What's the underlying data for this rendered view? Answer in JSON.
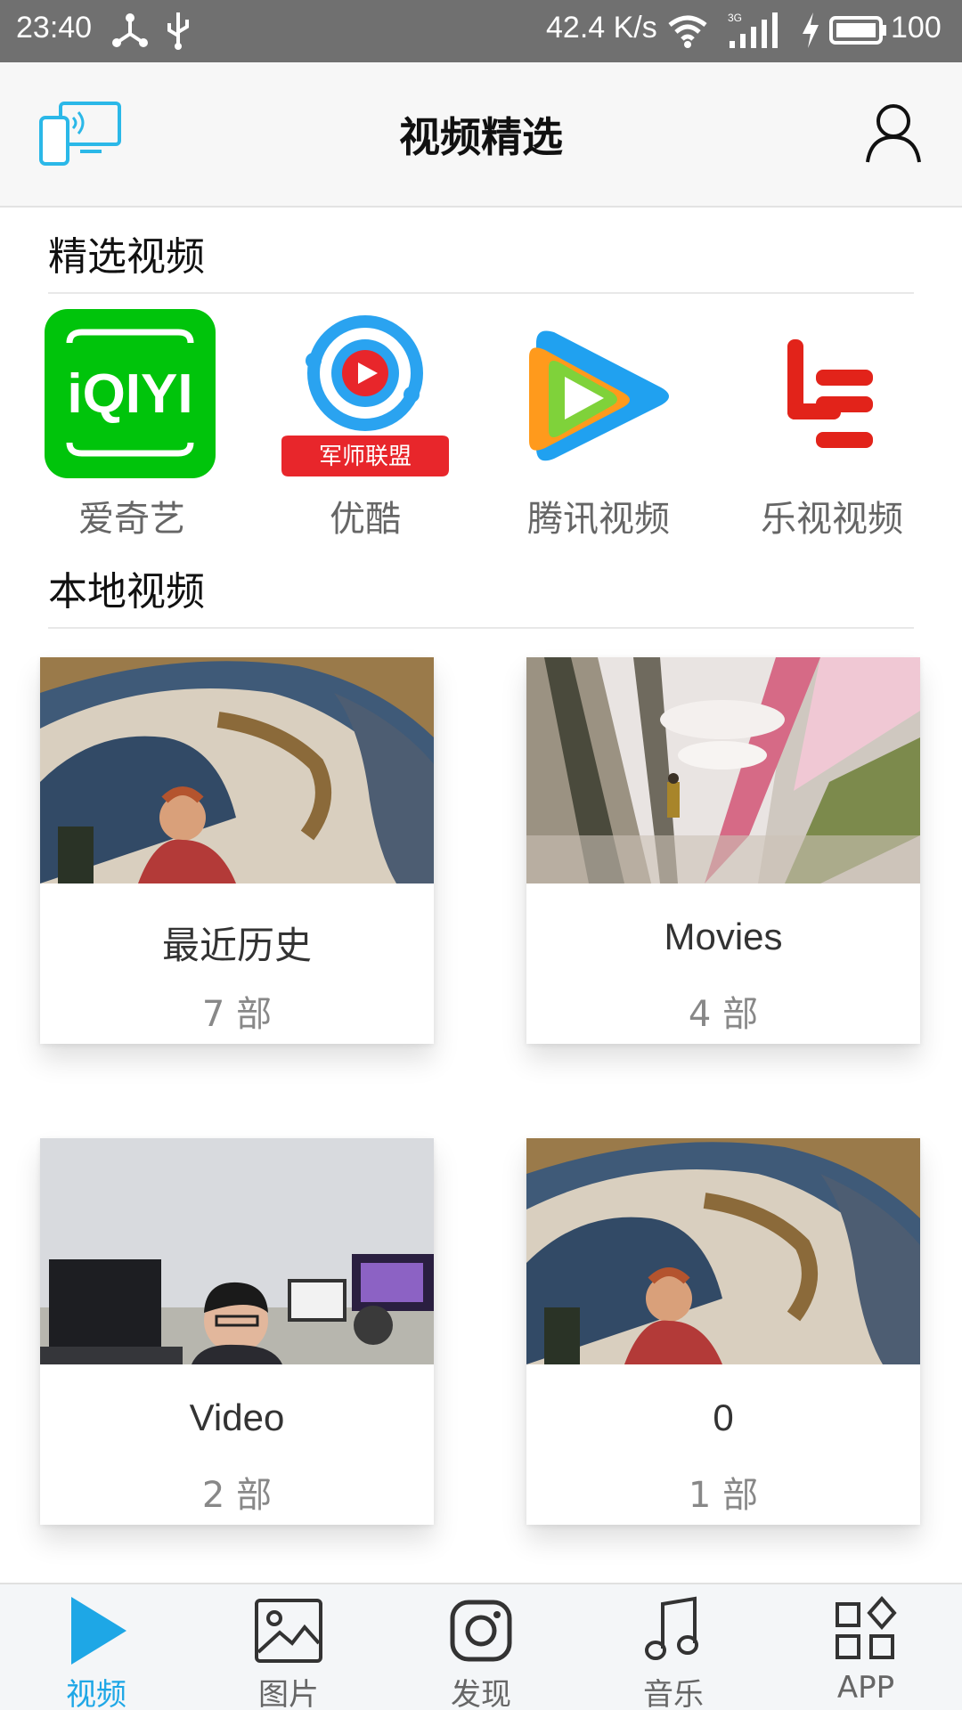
{
  "status_bar": {
    "time": "23:40",
    "speed": "42.4 K/s",
    "network": "3G",
    "battery": "100"
  },
  "header": {
    "title": "视频精选",
    "cast_icon": "screen-cast-icon",
    "user_icon": "user-icon"
  },
  "featured": {
    "heading": "精选视频",
    "apps": [
      {
        "name": "爱奇艺",
        "logo_text": "iQIYI",
        "icon": "iqiyi-logo"
      },
      {
        "name": "优酷",
        "logo_text": "军师联盟",
        "icon": "youku-logo"
      },
      {
        "name": "腾讯视频",
        "icon": "tencent-video-logo"
      },
      {
        "name": "乐视视频",
        "icon": "letv-logo"
      }
    ]
  },
  "local": {
    "heading": "本地视频",
    "folders": [
      {
        "label": "最近历史",
        "count": "7 部"
      },
      {
        "label": "Movies",
        "count": "4 部"
      },
      {
        "label": "Video",
        "count": "2 部"
      },
      {
        "label": "0",
        "count": "1 部"
      }
    ]
  },
  "bottom_nav": {
    "items": [
      {
        "label": "视频",
        "icon": "play-icon",
        "active": true
      },
      {
        "label": "图片",
        "icon": "image-icon"
      },
      {
        "label": "发现",
        "icon": "camera-icon"
      },
      {
        "label": "音乐",
        "icon": "music-note-icon"
      },
      {
        "label": "APP",
        "icon": "app-grid-icon"
      }
    ]
  },
  "colors": {
    "accent": "#1ea7e6",
    "iqiyi_green": "#00c40b",
    "letv_red": "#e2231a"
  }
}
